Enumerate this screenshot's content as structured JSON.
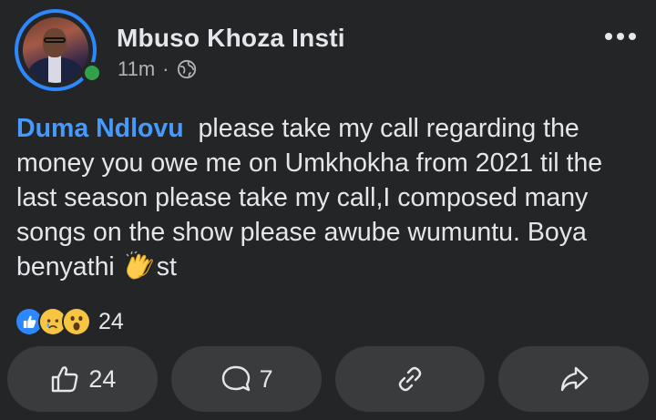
{
  "post": {
    "author": "Mbuso Khoza Insti",
    "time": "11m",
    "separator": "·",
    "privacy_icon": "globe-icon",
    "mention": "Duma Ndlovu",
    "text_main": "please take my call regarding the money you owe me on Umkhokha from 2021 til the last season please take my call,I composed many songs on the show please awube wumuntu. Boya benyathi",
    "text_tail": "st",
    "emoji": "clapping-hands-emoji"
  },
  "reactions": {
    "icons": [
      "like-icon",
      "sad-icon",
      "wow-icon"
    ],
    "count": "24"
  },
  "actions": {
    "like_count": "24",
    "comment_count": "7"
  },
  "colors": {
    "background": "#242526",
    "button_bg": "#3a3b3c",
    "mention": "#4599ff",
    "online": "#31a24c",
    "avatar_ring": "#2d88ff"
  }
}
